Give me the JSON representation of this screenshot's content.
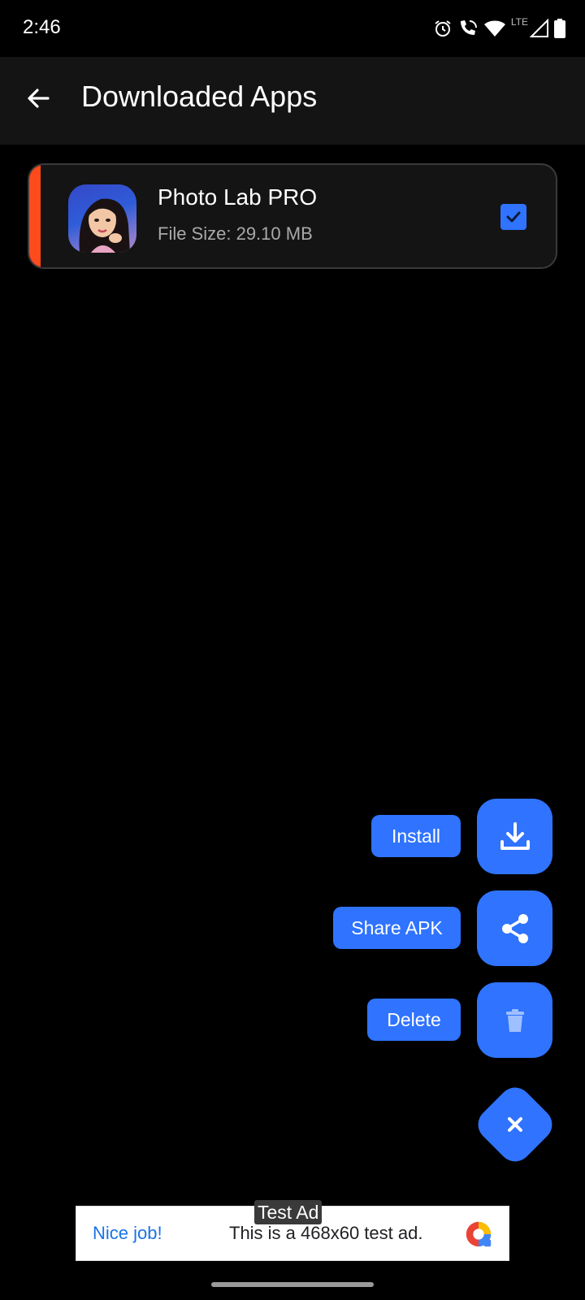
{
  "status_bar": {
    "time": "2:46",
    "network_label": "LTE",
    "icons": [
      "alarm-icon",
      "wifi-call-icon",
      "wifi-icon",
      "signal-icon",
      "battery-icon"
    ]
  },
  "app_bar": {
    "title": "Downloaded Apps",
    "back_icon": "arrow-left-icon"
  },
  "apps": [
    {
      "name": "Photo Lab PRO",
      "size": "File Size: 29.10 MB",
      "selected": true,
      "accent_color": "#ff4a1c"
    }
  ],
  "fab_menu": {
    "actions": [
      {
        "label": "Install",
        "icon": "download-icon"
      },
      {
        "label": "Share APK",
        "icon": "share-icon"
      },
      {
        "label": "Delete",
        "icon": "trash-icon"
      }
    ],
    "close_icon": "close-icon"
  },
  "ad": {
    "tag": "Test Ad",
    "headline": "Nice job!",
    "text": "This is a 468x60 test ad."
  },
  "colors": {
    "primary": "#2f73ff",
    "accent": "#ff4a1c",
    "background": "#000000",
    "surface": "#141414"
  }
}
